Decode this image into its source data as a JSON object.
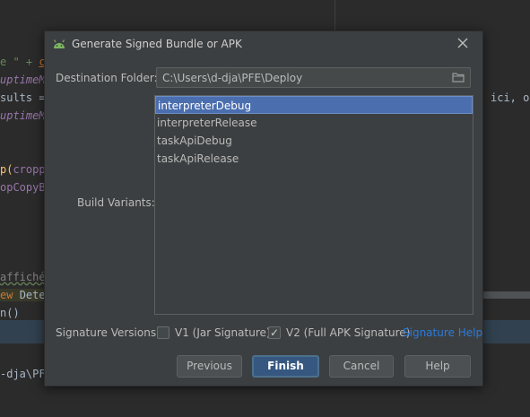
{
  "editor": {
    "line1_a": "e \" + ",
    "line1_b": "c",
    "line2": "uptimeM",
    "line3": "sults =",
    "line3_right": "ici, o",
    "line4": "uptimeM",
    "line5_a": "p(",
    "line5_b": "cropp",
    "line6": "opCopyB",
    "line7": "affiché",
    "line8_a": "ew ",
    "line8_b": "Dete",
    "line9": "n()",
    "line10": "-dja\\PF"
  },
  "dialog": {
    "title": "Generate Signed Bundle or APK",
    "destination_label": "Destination Folder:",
    "destination_value": "C:\\Users\\d-dja\\PFE\\Deploy",
    "build_variants_label": "Build Variants:",
    "variants": [
      "interpreterDebug",
      "interpreterRelease",
      "taskApiDebug",
      "taskApiRelease"
    ],
    "selected_variant": "interpreterDebug",
    "signature_label": "Signature Versions:",
    "v1_label": "V1 (Jar Signature)",
    "v1_checked": false,
    "v2_label": "V2 (Full APK Signature)",
    "v2_checked": true,
    "signature_help": "Signature Help",
    "buttons": {
      "previous": "Previous",
      "finish": "Finish",
      "cancel": "Cancel",
      "help": "Help"
    }
  },
  "icons": {
    "app": "android-icon",
    "close": "close-icon",
    "folder": "folder-icon"
  },
  "colors": {
    "accent": "#4b6eaf",
    "link": "#287bde",
    "primary_button": "#365880"
  }
}
